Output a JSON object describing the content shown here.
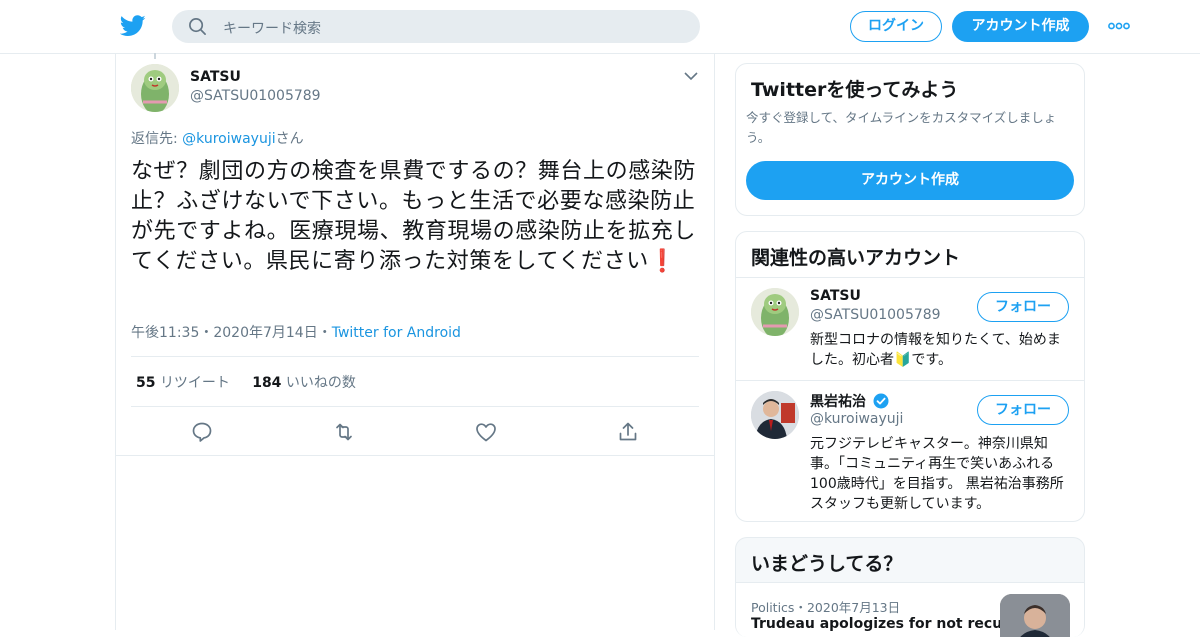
{
  "header": {
    "search_placeholder": "キーワード検索",
    "login_label": "ログイン",
    "signup_label": "アカウント作成"
  },
  "tweet": {
    "name": "SATSU",
    "handle": "@SATSU01005789",
    "reply_prefix": "返信先: ",
    "reply_handle": "@kuroiwayuji",
    "reply_suffix": "さん",
    "text": "なぜ？劇団の方の検査を県費でするの？舞台上の感染防止？ふざけないで下さい。もっと生活で必要な感染防止が先ですよね。医療現場、教育現場の感染防止を拡充してください。県民に寄り添った対策をしてください",
    "emoji": "❗",
    "time": "午後11:35",
    "sep": "・",
    "date": "2020年7月14日",
    "source": "Twitter for Android",
    "retweet_count": "55",
    "retweet_label": "リツイート",
    "like_count": "184",
    "like_label": "いいねの数"
  },
  "signup_card": {
    "title": "Twitterを使ってみよう",
    "desc": "今すぐ登録して、タイムラインをカスタマイズしましょう。",
    "cta": "アカウント作成"
  },
  "related": {
    "title": "関連性の高いアカウント",
    "accounts": [
      {
        "name": "SATSU",
        "handle": "@SATSU01005789",
        "follow": "フォロー",
        "bio": "新型コロナの情報を知りたくて、始めました。初心者🔰です。"
      },
      {
        "name": "黒岩祐治",
        "handle": "@kuroiwayuji",
        "follow": "フォロー",
        "bio": "元フジテレビキャスター。神奈川県知事。「コミュニティ再生で笑いあふれる100歳時代」を目指す。 黒岩祐治事務所スタッフも更新しています。"
      }
    ]
  },
  "trends": {
    "title": "いまどうしてる？",
    "items": [
      {
        "category": "Politics",
        "sep": "・",
        "date": "2020年7月13日",
        "headline": "Trudeau apologizes for not recusing"
      }
    ]
  },
  "colors": {
    "accent": "#1da1f2",
    "link": "#1b95e0",
    "muted": "#657786",
    "border": "#e6ecf0"
  }
}
